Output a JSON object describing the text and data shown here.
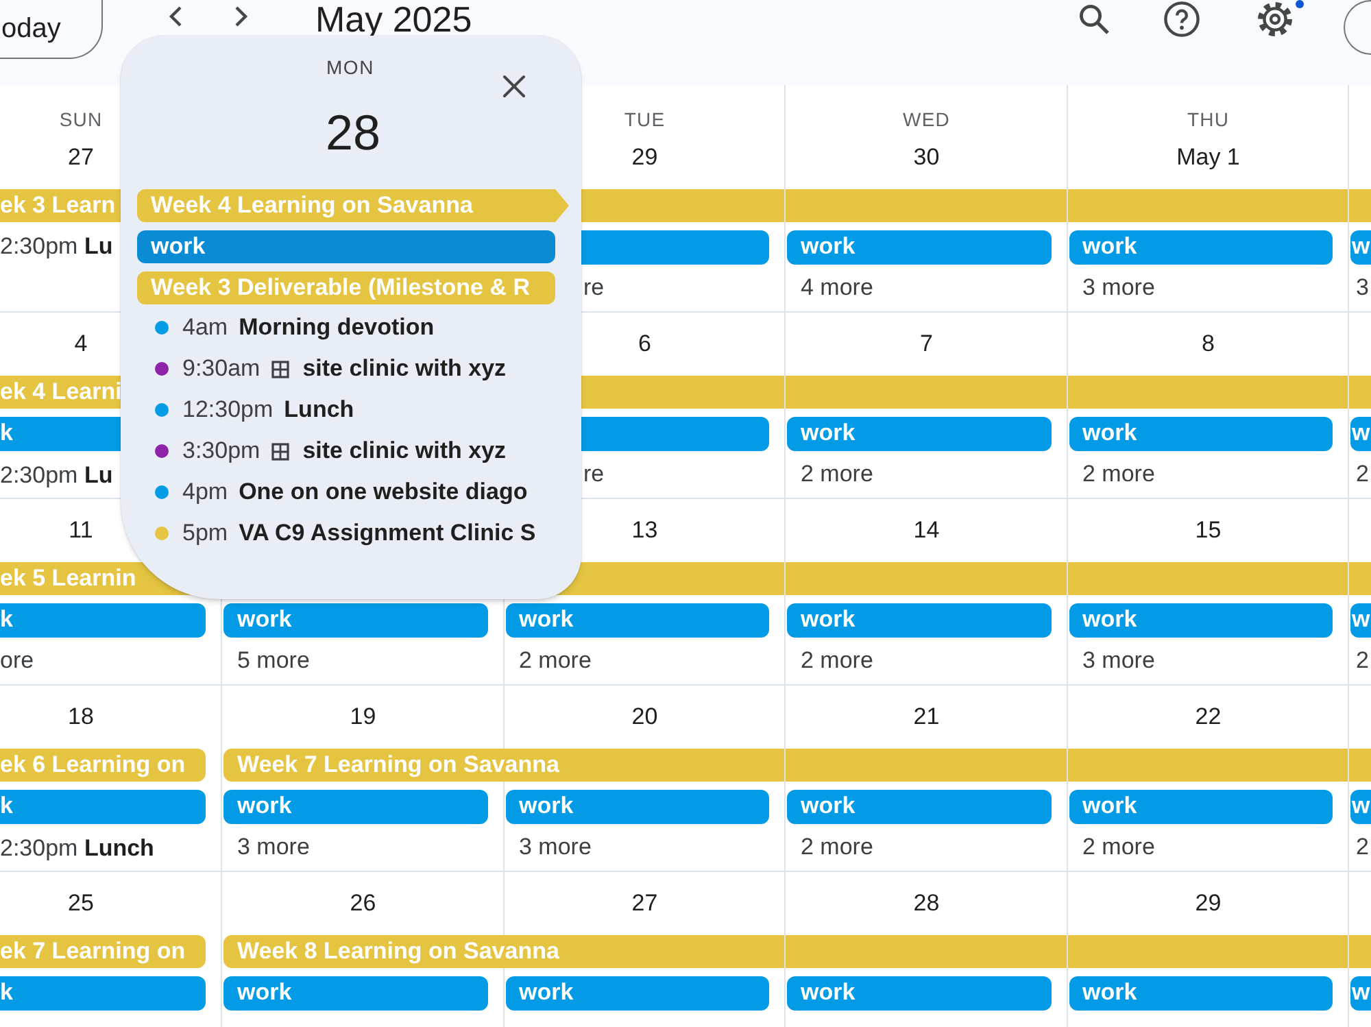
{
  "header": {
    "today_button": "oday",
    "title": "May 2025"
  },
  "weeks": [
    {
      "days": [
        {
          "day_name": "SUN",
          "date": "27",
          "items": [
            {
              "kind": "chip",
              "label": "ek 3 Learn",
              "color": "#e4c441",
              "continues": false
            },
            {
              "kind": "timed",
              "time": "2:30pm",
              "title": "Lu"
            }
          ]
        },
        {
          "items": [
            {
              "kind": "chip",
              "color": "#e4c441",
              "continues": true
            }
          ]
        },
        {
          "day_name": "TUE",
          "date": "29",
          "items": [
            {
              "kind": "chip",
              "color": "#039be5",
              "continues": false
            },
            {
              "kind": "more",
              "label": "re"
            }
          ]
        },
        {
          "day_name": "WED",
          "date": "30",
          "items": [
            {
              "kind": "chip",
              "label": "work",
              "color": "#039be5",
              "continues": false
            },
            {
              "kind": "more",
              "label": "4 more"
            }
          ]
        },
        {
          "day_name": "THU",
          "date": "May 1",
          "items": [
            {
              "kind": "chip",
              "label": "work",
              "color": "#039be5",
              "continues": false
            },
            {
              "kind": "more",
              "label": "3 more"
            }
          ]
        },
        {
          "items": [
            {
              "kind": "chip",
              "label": "w",
              "color": "#039be5",
              "continues": false
            },
            {
              "kind": "more",
              "label": "3"
            }
          ]
        }
      ]
    },
    {
      "days": [
        {
          "date": "4",
          "items": [
            {
              "kind": "chip",
              "label": "ek 4 Learni",
              "color": "#e4c441",
              "continues": false
            },
            {
              "kind": "chip",
              "label": "k",
              "color": "#039be5",
              "continues": false
            },
            {
              "kind": "timed",
              "time": "2:30pm",
              "title": "Lu"
            }
          ]
        },
        {
          "items": [
            {
              "kind": "chip",
              "color": "#e4c441",
              "continues": true
            }
          ]
        },
        {
          "date": "6",
          "items": [
            {
              "kind": "chip",
              "color": "#039be5",
              "continues": false
            },
            {
              "kind": "more",
              "label": "re"
            }
          ]
        },
        {
          "date": "7",
          "items": [
            {
              "kind": "chip",
              "label": "work",
              "color": "#039be5",
              "continues": false
            },
            {
              "kind": "more",
              "label": "2 more"
            }
          ]
        },
        {
          "date": "8",
          "items": [
            {
              "kind": "chip",
              "label": "work",
              "color": "#039be5",
              "continues": false
            },
            {
              "kind": "more",
              "label": "2 more"
            }
          ]
        },
        {
          "items": [
            {
              "kind": "chip",
              "label": "w",
              "color": "#039be5",
              "continues": false
            },
            {
              "kind": "more",
              "label": "2"
            }
          ]
        }
      ]
    },
    {
      "days": [
        {
          "date": "11",
          "items": [
            {
              "kind": "chip",
              "label": "ek 5 Learnin",
              "color": "#e4c441",
              "continues": false
            },
            {
              "kind": "chip",
              "label": "k",
              "color": "#039be5",
              "continues": false
            },
            {
              "kind": "more",
              "label": "ore"
            }
          ]
        },
        {
          "items": [
            {
              "kind": "chip",
              "color": "#e4c441",
              "continues": true
            },
            {
              "kind": "chip",
              "label": "work",
              "color": "#039be5",
              "continues": false
            },
            {
              "kind": "more",
              "label": "5 more"
            }
          ]
        },
        {
          "date": "13",
          "items": [
            {
              "kind": "chip",
              "label": "work",
              "color": "#039be5",
              "continues": false
            },
            {
              "kind": "more",
              "label": "2 more"
            }
          ]
        },
        {
          "date": "14",
          "items": [
            {
              "kind": "chip",
              "label": "work",
              "color": "#039be5",
              "continues": false
            },
            {
              "kind": "more",
              "label": "2 more"
            }
          ]
        },
        {
          "date": "15",
          "items": [
            {
              "kind": "chip",
              "label": "work",
              "color": "#039be5",
              "continues": false
            },
            {
              "kind": "more",
              "label": "3 more"
            }
          ]
        },
        {
          "items": [
            {
              "kind": "chip",
              "label": "w",
              "color": "#039be5",
              "continues": false
            },
            {
              "kind": "more",
              "label": "2"
            }
          ]
        }
      ]
    },
    {
      "days": [
        {
          "date": "18",
          "items": [
            {
              "kind": "chip",
              "label": "ek 6 Learning on",
              "color": "#e4c441",
              "continues": false
            },
            {
              "kind": "chip",
              "label": "k",
              "color": "#039be5",
              "continues": false
            },
            {
              "kind": "timed",
              "time": "2:30pm",
              "title": "Lunch"
            }
          ]
        },
        {
          "date": "19",
          "items": [
            {
              "kind": "chip",
              "label": "Week 7 Learning on Savanna",
              "color": "#e4c441",
              "continues": true
            },
            {
              "kind": "chip",
              "label": "work",
              "color": "#039be5",
              "continues": false
            },
            {
              "kind": "more",
              "label": "3 more"
            }
          ]
        },
        {
          "date": "20",
          "items": [
            {
              "kind": "chip",
              "label": "work",
              "color": "#039be5",
              "continues": false
            },
            {
              "kind": "more",
              "label": "3 more"
            }
          ]
        },
        {
          "date": "21",
          "items": [
            {
              "kind": "chip",
              "label": "work",
              "color": "#039be5",
              "continues": false
            },
            {
              "kind": "more",
              "label": "2 more"
            }
          ]
        },
        {
          "date": "22",
          "items": [
            {
              "kind": "chip",
              "label": "work",
              "color": "#039be5",
              "continues": false
            },
            {
              "kind": "more",
              "label": "2 more"
            }
          ]
        },
        {
          "items": [
            {
              "kind": "chip",
              "label": "w",
              "color": "#039be5",
              "continues": false
            },
            {
              "kind": "more",
              "label": "2"
            }
          ]
        }
      ]
    },
    {
      "days": [
        {
          "date": "25",
          "items": [
            {
              "kind": "chip",
              "label": "ek 7 Learning on",
              "color": "#e4c441",
              "continues": false
            },
            {
              "kind": "chip",
              "label": "k",
              "color": "#039be5",
              "continues": false
            }
          ]
        },
        {
          "date": "26",
          "items": [
            {
              "kind": "chip",
              "label": "Week 8 Learning on Savanna",
              "color": "#e4c441",
              "continues": true
            },
            {
              "kind": "chip",
              "label": "work",
              "color": "#039be5",
              "continues": false
            }
          ]
        },
        {
          "date": "27",
          "items": [
            {
              "kind": "chip",
              "label": "work",
              "color": "#039be5",
              "continues": false
            }
          ]
        },
        {
          "date": "28",
          "items": [
            {
              "kind": "chip",
              "label": "work",
              "color": "#039be5",
              "continues": false
            }
          ]
        },
        {
          "date": "29",
          "items": [
            {
              "kind": "chip",
              "label": "work",
              "color": "#039be5",
              "continues": false
            }
          ]
        },
        {
          "items": [
            {
              "kind": "chip",
              "label": "w",
              "color": "#039be5",
              "continues": false
            }
          ]
        }
      ]
    }
  ],
  "popup": {
    "day_name": "MON",
    "date": "28",
    "chips": [
      {
        "label": "Week 4 Learning on Savanna",
        "color": "#e4c441",
        "continues": true
      },
      {
        "label": "work",
        "color": "#0b8bd3",
        "continues": false
      },
      {
        "label": "Week 3 Deliverable (Milestone & R",
        "color": "#e4c441",
        "continues": false
      }
    ],
    "events": [
      {
        "kind": "plain",
        "time": "4am",
        "title": "Morning devotion",
        "color": "#039be5"
      },
      {
        "kind": "booking",
        "time": "9:30am",
        "title": "site clinic with xyz",
        "color": "#8e24aa"
      },
      {
        "kind": "plain",
        "time": "12:30pm",
        "title": "Lunch",
        "color": "#039be5"
      },
      {
        "kind": "booking",
        "time": "3:30pm",
        "title": "site clinic with xyz",
        "color": "#8e24aa"
      },
      {
        "kind": "plain",
        "time": "4pm",
        "title": "One on one website diago",
        "color": "#039be5"
      },
      {
        "kind": "plain",
        "time": "5pm",
        "title": "VA C9 Assignment Clinic S",
        "color": "#e4c441"
      }
    ]
  }
}
